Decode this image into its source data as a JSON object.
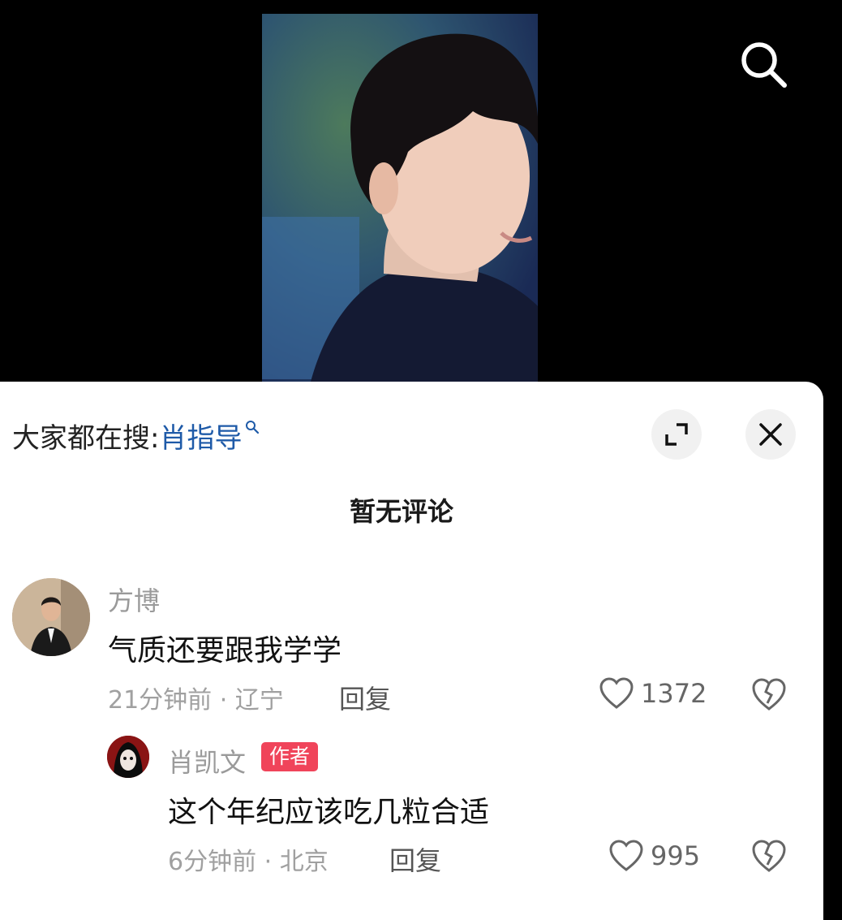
{
  "search": {
    "icon": "search-icon"
  },
  "hot_search": {
    "prefix": "大家都在搜:",
    "keyword": "肖指导"
  },
  "panel": {
    "expand_icon": "expand-icon",
    "close_icon": "close-icon",
    "empty_text": "暂无评论"
  },
  "comments": [
    {
      "user": "方博",
      "text": "气质还要跟我学学",
      "time_location": "21分钟前 · 辽宁",
      "reply_label": "回复",
      "likes": "1372"
    }
  ],
  "reply": {
    "user": "肖凯文",
    "badge": "作者",
    "text": "这个年纪应该吃几粒合适",
    "time_location": "6分钟前 · 北京",
    "reply_label": "回复",
    "likes": "995"
  },
  "colors": {
    "keyword": "#1e5aa8",
    "badge": "#f0445a"
  }
}
